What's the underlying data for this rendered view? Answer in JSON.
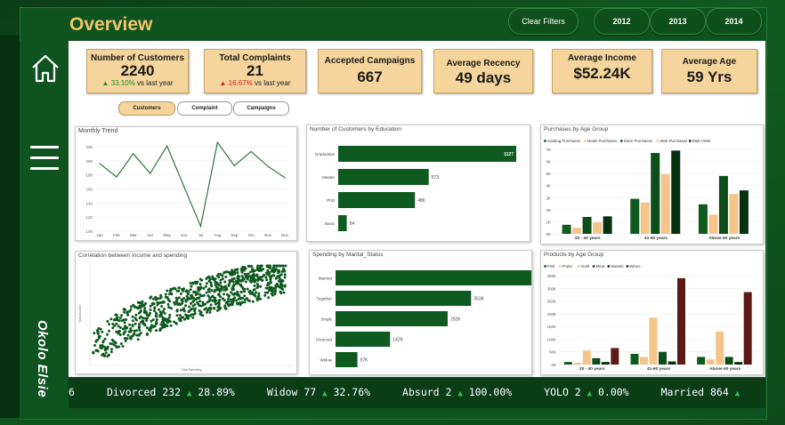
{
  "header": {
    "title": "Overview"
  },
  "filters": {
    "clear": "Clear Filters",
    "years": [
      "2012",
      "2013",
      "2014"
    ]
  },
  "author": "Okolo Elsie",
  "kpis": [
    {
      "title": "Number of Customers",
      "value": "2240",
      "delta_dir": "up",
      "delta": "33.10%",
      "delta_text": "vs last year"
    },
    {
      "title": "Total Complaints",
      "value": "21",
      "delta_dir": "down",
      "delta": "16.67%",
      "delta_text": "vs last year"
    },
    {
      "title": "Accepted Campaigns",
      "value": "667"
    },
    {
      "title": "Average Recency",
      "value": "49 days"
    },
    {
      "title": "Average Income",
      "value": "$52.24K"
    },
    {
      "title": "Average Age",
      "value": "59 Yrs"
    }
  ],
  "toggles": {
    "customers": "Customers",
    "complaint": "Complaint",
    "campaigns": "Campaigns"
  },
  "ticker": [
    {
      "label": "Divorced 232",
      "pct": "28.89%"
    },
    {
      "label": "Widow 77",
      "pct": "32.76%"
    },
    {
      "label": "Absurd 2",
      "pct": "100.00%"
    },
    {
      "label": "YOLO 2",
      "pct": "0.00%"
    },
    {
      "label": "Married 864",
      "pct": ""
    }
  ],
  "ticker_prefix": "6",
  "chart_data": [
    {
      "id": "monthly",
      "type": "line",
      "title": "Monthly Trend",
      "categories": [
        "Jan",
        "Feb",
        "Mar",
        "Apr",
        "May",
        "Jun",
        "Jul",
        "Aug",
        "Sep",
        "Oct",
        "Nov",
        "Dec"
      ],
      "values": [
        196,
        177,
        210,
        182,
        221,
        164,
        107,
        226,
        193,
        213,
        192,
        176
      ],
      "yticks": [
        "100",
        "120",
        "140",
        "160",
        "180",
        "200",
        "220"
      ],
      "ylim": [
        100,
        230
      ],
      "color": "#1f6b2c"
    },
    {
      "id": "education",
      "type": "bar",
      "orientation": "horizontal",
      "title": "Number of Customers by Education",
      "categories": [
        "Graduation",
        "Master",
        "PhD",
        "Basic"
      ],
      "values": [
        1127,
        573,
        486,
        54
      ],
      "labels": [
        "1127",
        "573",
        "486",
        "54"
      ],
      "color": "#0e5a1f"
    },
    {
      "id": "purchases_age",
      "type": "bar",
      "title": "Purchases by Age Group",
      "categories": [
        "20 - 40 years",
        "41-60 years",
        "Above 60 years"
      ],
      "series": [
        {
          "name": "Catalog Purchases",
          "color": "#0e5a1f",
          "values": [
            750,
            2900,
            2450
          ]
        },
        {
          "name": "Deals Purchases",
          "color": "#f5c48a",
          "values": [
            500,
            2600,
            1600
          ]
        },
        {
          "name": "Store Purchases",
          "color": "#0d4d1a",
          "values": [
            1400,
            6700,
            4800
          ]
        },
        {
          "name": "Web Purchases",
          "color": "#f5c48a",
          "values": [
            950,
            4950,
            3300
          ]
        },
        {
          "name": "Web Visits",
          "color": "#08310f",
          "values": [
            1450,
            6900,
            3600
          ]
        }
      ],
      "yticks": [
        "0K",
        "1K",
        "2K",
        "3K",
        "4K",
        "5K",
        "6K",
        "7K"
      ],
      "ylim": [
        0,
        7000
      ]
    },
    {
      "id": "scatter",
      "type": "scatter",
      "title": "Correlation between Income and spending",
      "xlabel": "Total Spending",
      "ylabel": "Total Income",
      "color": "#0e5a1f"
    },
    {
      "id": "marital",
      "type": "bar",
      "orientation": "horizontal",
      "title": "Spending by Marital_Status",
      "categories": [
        "Married",
        "Together",
        "Single",
        "Divorced",
        "Widow"
      ],
      "values": [
        510,
        353,
        292,
        142,
        57
      ],
      "labels": [
        "510K",
        "353K",
        "292K",
        "142K",
        "57K"
      ],
      "color": "#0e5a1f"
    },
    {
      "id": "products_age",
      "type": "bar",
      "title": "Products by Age Group",
      "categories": [
        "20 - 40 years",
        "41-60 years",
        "Above 60 years"
      ],
      "series": [
        {
          "name": "Fish",
          "color": "#0e5a1f",
          "values": [
            10000,
            42000,
            30000
          ]
        },
        {
          "name": "Fruits",
          "color": "#f5c48a",
          "values": [
            7000,
            30000,
            20000
          ]
        },
        {
          "name": "Gold",
          "color": "#f5c48a",
          "values": [
            55000,
            185000,
            130000
          ]
        },
        {
          "name": "Meat",
          "color": "#0d4d1a",
          "values": [
            25000,
            50000,
            30000
          ]
        },
        {
          "name": "Sweets",
          "color": "#08310f",
          "values": [
            10000,
            12000,
            10000
          ]
        },
        {
          "name": "Wines",
          "color": "#5c1a14",
          "values": [
            65000,
            340000,
            285000
          ]
        }
      ],
      "yticks": [
        "0K",
        "50K",
        "100K",
        "150K",
        "200K",
        "250K",
        "300K",
        "350K"
      ],
      "ylim": [
        0,
        350000
      ]
    }
  ]
}
